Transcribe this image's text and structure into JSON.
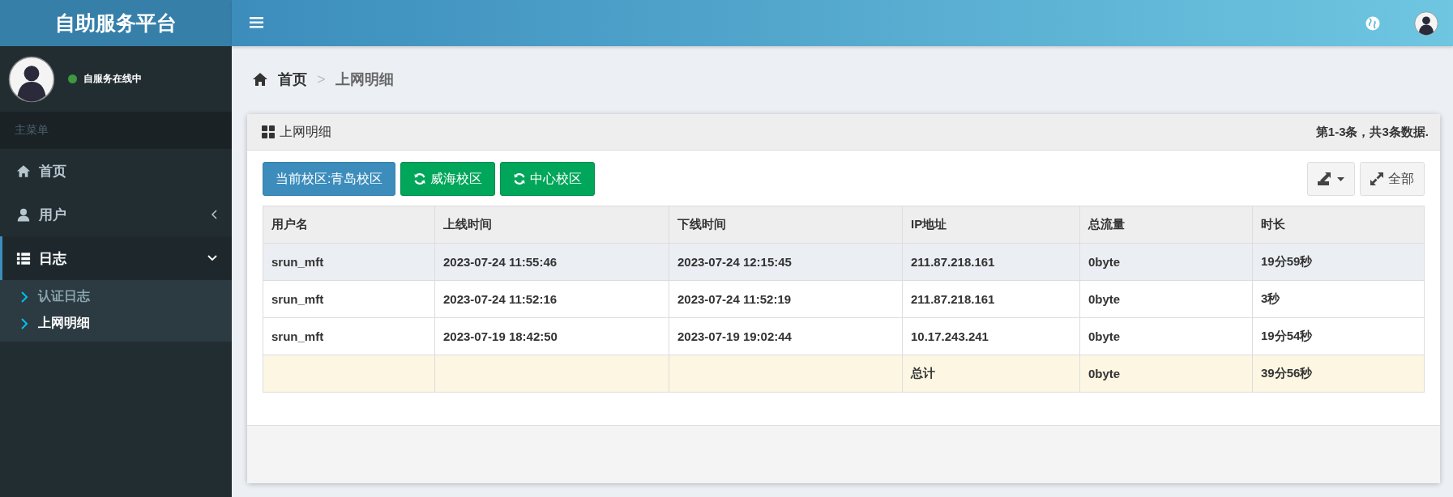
{
  "header": {
    "brand": "自助服务平台"
  },
  "sidebar": {
    "user_status": "自服务在线中",
    "online": true,
    "menu_heading": "主菜单",
    "items": [
      {
        "label": "首页",
        "kind": "link",
        "selected": false
      },
      {
        "label": "用户",
        "kind": "group",
        "selected": false,
        "expanded": false
      },
      {
        "label": "日志",
        "kind": "group",
        "selected": true,
        "expanded": true,
        "children": [
          {
            "label": "认证日志",
            "selected": false
          },
          {
            "label": "上网明细",
            "selected": true
          }
        ]
      }
    ]
  },
  "breadcrumb": [
    {
      "label": "首页"
    },
    {
      "label": "上网明细"
    }
  ],
  "breadcrumb_separator": ">",
  "card": {
    "title": "上网明细",
    "summary": "第1-3条，共3条数据.",
    "campus_buttons": [
      {
        "label": "当前校区:青岛校区",
        "kind": "current"
      },
      {
        "label": "威海校区",
        "kind": "switch"
      },
      {
        "label": "中心校区",
        "kind": "switch"
      }
    ],
    "show_all_label": "全部",
    "table": {
      "columns": [
        "用户名",
        "上线时间",
        "下线时间",
        "IP地址",
        "总流量",
        "时长"
      ],
      "rows": [
        {
          "kind": "data",
          "selected": true,
          "cells": [
            "srun_mft",
            "2023-07-24 11:55:46",
            "2023-07-24 12:15:45",
            "211.87.218.161",
            "0byte",
            "19分59秒"
          ]
        },
        {
          "kind": "data",
          "selected": false,
          "cells": [
            "srun_mft",
            "2023-07-24 11:52:16",
            "2023-07-24 11:52:19",
            "211.87.218.161",
            "0byte",
            "3秒"
          ]
        },
        {
          "kind": "data",
          "selected": false,
          "cells": [
            "srun_mft",
            "2023-07-19 18:42:50",
            "2023-07-19 19:02:44",
            "10.17.243.241",
            "0byte",
            "19分54秒"
          ]
        },
        {
          "kind": "total",
          "selected": false,
          "cells": [
            "",
            "",
            "",
            "总计",
            "0byte",
            "39分56秒"
          ]
        }
      ]
    }
  }
}
